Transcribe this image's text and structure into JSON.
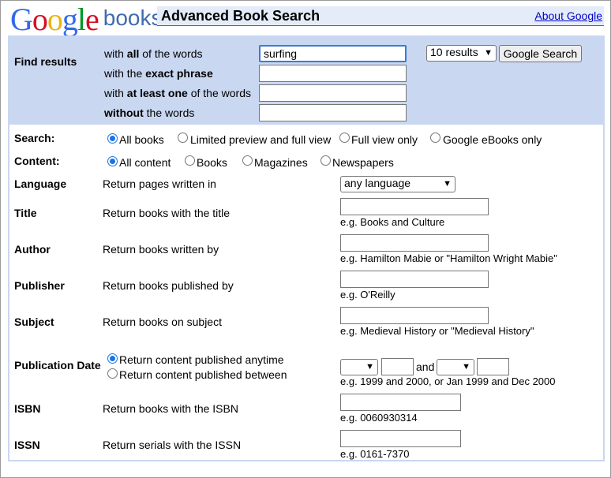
{
  "header": {
    "logo_google_letters": [
      {
        "ch": "G",
        "color": "#3369e8"
      },
      {
        "ch": "o",
        "color": "#d50f25"
      },
      {
        "ch": "o",
        "color": "#eeb211"
      },
      {
        "ch": "g",
        "color": "#3369e8"
      },
      {
        "ch": "l",
        "color": "#009925"
      },
      {
        "ch": "e",
        "color": "#d50f25"
      }
    ],
    "logo_books": "books",
    "title": "Advanced Book Search",
    "about_link": "About Google"
  },
  "find": {
    "heading": "Find results",
    "all_words": {
      "pre": "with ",
      "bold": "all",
      "post": " of the words",
      "value": "surfing"
    },
    "exact_phrase": {
      "pre": "with the ",
      "bold": "exact phrase",
      "post": "",
      "value": ""
    },
    "at_least_one": {
      "pre": "with ",
      "bold": "at least one",
      "post": " of the words",
      "value": ""
    },
    "without": {
      "pre": "",
      "bold": "without",
      "post": " the words",
      "value": ""
    },
    "results_select": "10 results",
    "search_button": "Google Search"
  },
  "search_filter": {
    "label": "Search:",
    "options": [
      {
        "label": "All books",
        "checked": true
      },
      {
        "label": "Limited preview and full view",
        "checked": false
      },
      {
        "label": "Full view only",
        "checked": false
      },
      {
        "label": "Google eBooks only",
        "checked": false
      }
    ]
  },
  "content_filter": {
    "label": "Content:",
    "options": [
      {
        "label": "All content",
        "checked": true
      },
      {
        "label": "Books",
        "checked": false
      },
      {
        "label": "Magazines",
        "checked": false
      },
      {
        "label": "Newspapers",
        "checked": false
      }
    ]
  },
  "language": {
    "label": "Language",
    "desc": "Return pages written in",
    "select": "any language"
  },
  "title_row": {
    "label": "Title",
    "desc": "Return books with the title",
    "hint": "e.g. Books and Culture"
  },
  "author_row": {
    "label": "Author",
    "desc": "Return books written by",
    "hint": "e.g. Hamilton Mabie or \"Hamilton Wright Mabie\""
  },
  "publisher_row": {
    "label": "Publisher",
    "desc": "Return books published by",
    "hint": "e.g. O'Reilly"
  },
  "subject_row": {
    "label": "Subject",
    "desc": "Return books on subject",
    "hint": "e.g. Medieval History or \"Medieval History\""
  },
  "pubdate": {
    "label": "Publication Date",
    "anytime": "Return content published anytime",
    "between": "Return content published between",
    "anytime_checked": true,
    "and_text": "and",
    "hint": "e.g. 1999 and 2000, or Jan 1999 and Dec 2000"
  },
  "isbn": {
    "label": "ISBN",
    "desc": "Return books with the ISBN",
    "hint": "e.g. 0060930314"
  },
  "issn": {
    "label": "ISSN",
    "desc": "Return serials with the ISSN",
    "hint": "e.g. 0161-7370"
  }
}
